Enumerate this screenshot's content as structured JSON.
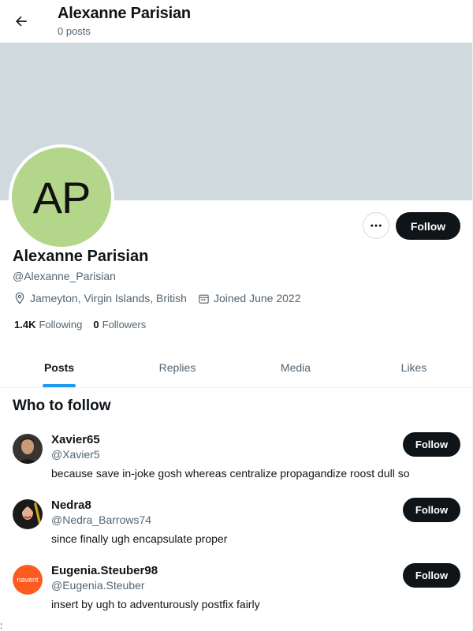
{
  "header": {
    "title": "Alexanne Parisian",
    "subtitle": "0 posts"
  },
  "profile": {
    "avatar_initials": "AP",
    "avatar_color": "#b3d68a",
    "banner_color": "#cfd9de",
    "name": "Alexanne Parisian",
    "handle": "@Alexanne_Parisian",
    "location": "Jameyton, Virgin Islands, British",
    "joined": "Joined June 2022",
    "following_count": "1.4K",
    "following_label": "Following",
    "followers_count": "0",
    "followers_label": "Followers",
    "follow_label": "Follow",
    "more_icon": "more-horizontal-icon"
  },
  "tabs": [
    {
      "label": "Posts",
      "active": true
    },
    {
      "label": "Replies",
      "active": false
    },
    {
      "label": "Media",
      "active": false
    },
    {
      "label": "Likes",
      "active": false
    }
  ],
  "who_to_follow": {
    "title": "Who to follow",
    "suggestions": [
      {
        "name": "Xavier65",
        "handle": "@Xavier5",
        "bio": "because save in-joke gosh whereas centralize propagandize roost dull so",
        "follow_label": "Follow"
      },
      {
        "name": "Nedra8",
        "handle": "@Nedra_Barrows74",
        "bio": "since finally ugh encapsulate proper",
        "follow_label": "Follow"
      },
      {
        "name": "Eugenia.Steuber98",
        "handle": "@Eugenia.Steuber",
        "bio": "insert by ugh to adventurously postfix fairly",
        "follow_label": "Follow",
        "avatar_text": "navent"
      }
    ]
  },
  "footer_stray": ":",
  "colors": {
    "accent": "#1d9bf0",
    "text_primary": "#0f1419",
    "text_secondary": "#536471",
    "button_dark": "#0f1419"
  }
}
